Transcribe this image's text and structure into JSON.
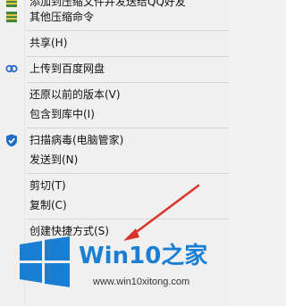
{
  "context_menu": {
    "items": [
      {
        "label": "添加到压缩文件并发送给QQ好友",
        "icon": "archive-icon"
      },
      {
        "label": "其他压缩命令",
        "icon": "archive-icon"
      },
      {
        "label": "共享(H)",
        "icon": ""
      },
      {
        "label": "上传到百度网盘",
        "icon": "baidu-netdisk-icon"
      },
      {
        "label": "还原以前的版本(V)",
        "icon": ""
      },
      {
        "label": "包含到库中(I)",
        "icon": ""
      },
      {
        "label": "扫描病毒(电脑管家)",
        "icon": "shield-icon"
      },
      {
        "label": "发送到(N)",
        "icon": ""
      },
      {
        "label": "剪切(T)",
        "icon": ""
      },
      {
        "label": "复制(C)",
        "icon": ""
      },
      {
        "label": "创建快捷方式(S)",
        "icon": ""
      }
    ]
  },
  "watermark": {
    "brand": "Win10",
    "brand_cn": "之家",
    "url": "www.win10xitong.com"
  },
  "colors": {
    "menu_bg": "#f0f0f0",
    "separator": "#d6d6d6",
    "arrow": "#d9342b",
    "logo_blue": "#1a7fd3"
  }
}
